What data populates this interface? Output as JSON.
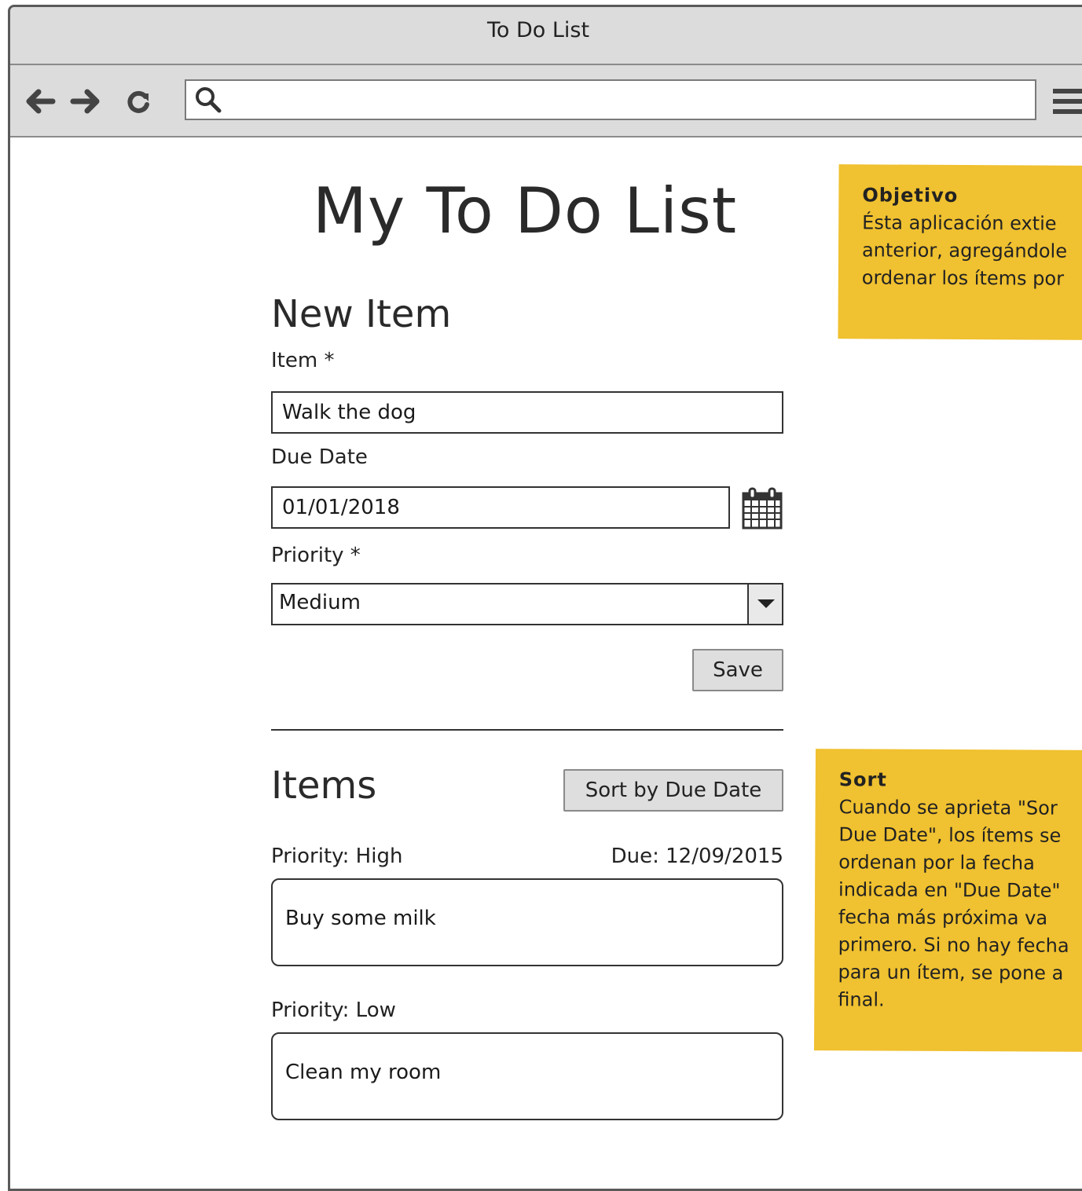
{
  "window": {
    "title": "To Do List"
  },
  "browser": {
    "address_value": ""
  },
  "page": {
    "title": "My To Do List",
    "new_item": {
      "heading": "New Item",
      "item_label": "Item *",
      "item_value": "Walk the dog",
      "due_label": "Due Date",
      "due_value": "01/01/2018",
      "priority_label": "Priority *",
      "priority_value": "Medium",
      "save_label": "Save"
    },
    "items": {
      "heading": "Items",
      "sort_label": "Sort by Due Date",
      "list": [
        {
          "priority": "Priority: High",
          "due": "Due: 12/09/2015",
          "text": "Buy some milk"
        },
        {
          "priority": "Priority: Low",
          "due": "",
          "text": "Clean my room"
        }
      ]
    }
  },
  "notes": [
    {
      "title": "Objetivo",
      "body": "Ésta aplicación extie\nanterior, agregándole\nordenar los ítems por"
    },
    {
      "title": "Sort",
      "body": "Cuando se aprieta \"Sor\nDue Date\", los ítems se\nordenan por la fecha\nindicada en \"Due Date\"\nfecha más próxima va\nprimero. Si no hay fecha\npara un ítem, se pone a\nfinal."
    }
  ],
  "icons": {
    "back": "back-arrow-icon",
    "forward": "forward-arrow-icon",
    "reload": "reload-icon",
    "search": "search-icon",
    "menu": "hamburger-menu-icon",
    "calendar": "calendar-icon"
  },
  "colors": {
    "note_bg": "#f0c130",
    "chrome_bg": "#dcdcdc"
  }
}
